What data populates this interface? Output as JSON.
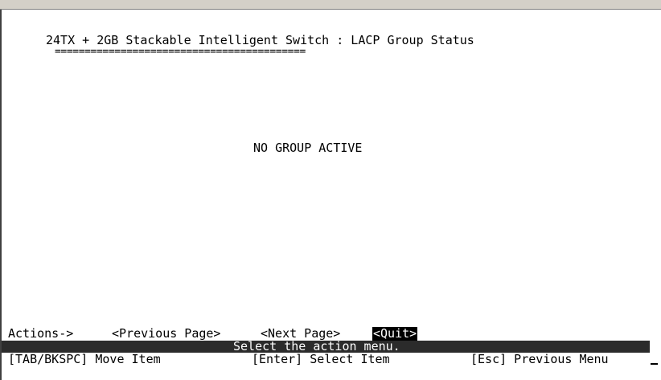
{
  "header": {
    "title": "24TX + 2GB Stackable Intelligent Switch : LACP Group Status",
    "underline": "=========================================="
  },
  "main": {
    "message": "NO GROUP ACTIVE"
  },
  "actions": {
    "label": "Actions->",
    "items": [
      {
        "label": "<Previous Page>",
        "selected": false
      },
      {
        "label": "<Next Page>",
        "selected": false
      },
      {
        "label": "<Quit>",
        "selected": true
      }
    ]
  },
  "status": {
    "text": "Select the action menu."
  },
  "help": {
    "move": "[TAB/BKSPC] Move Item",
    "select": "[Enter] Select Item",
    "previous": "[Esc] Previous Menu"
  },
  "colors": {
    "background": "#ffffff",
    "text": "#000000",
    "status_bar": "#2b2b2b",
    "highlight": "#000000"
  }
}
